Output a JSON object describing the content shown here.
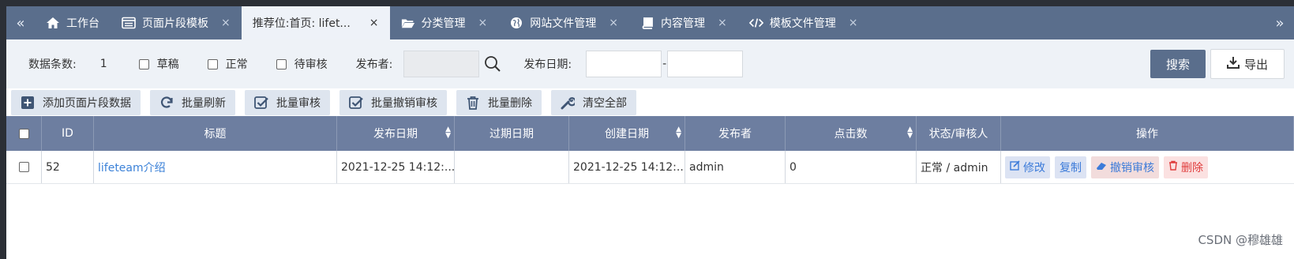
{
  "tabs": {
    "items": [
      {
        "label": "工作台",
        "icon": "home-icon"
      },
      {
        "label": "页面片段模板",
        "icon": "template-icon",
        "closable": true
      },
      {
        "label": "推荐位:首页: lifet...",
        "active": true,
        "closable": true
      },
      {
        "label": "分类管理",
        "icon": "folder-icon",
        "closable": true
      },
      {
        "label": "网站文件管理",
        "icon": "globe-icon",
        "closable": true
      },
      {
        "label": "内容管理",
        "icon": "book-icon",
        "closable": true
      },
      {
        "label": "模板文件管理",
        "icon": "code-icon",
        "closable": true
      }
    ],
    "close_glyph": "×",
    "prev_glyph": "«",
    "next_glyph": "»"
  },
  "search": {
    "count_label": "数据条数:",
    "count_value": "1",
    "status_options": [
      "草稿",
      "正常",
      "待审核"
    ],
    "publisher_label": "发布者:",
    "publisher_value": "",
    "date_label": "发布日期:",
    "date_from": "",
    "date_to": "",
    "date_sep": "-",
    "search_button": "搜索",
    "export_button": "导出"
  },
  "toolbar": {
    "buttons": [
      {
        "label": "添加页面片段数据",
        "icon": "plus-square-icon"
      },
      {
        "label": "批量刷新",
        "icon": "refresh-icon"
      },
      {
        "label": "批量审核",
        "icon": "check-square-icon"
      },
      {
        "label": "批量撤销审核",
        "icon": "check-square-icon"
      },
      {
        "label": "批量删除",
        "icon": "trash-icon"
      },
      {
        "label": "清空全部",
        "icon": "wrench-icon"
      }
    ]
  },
  "table": {
    "headers": [
      "ID",
      "标题",
      "发布日期",
      "过期日期",
      "创建日期",
      "发布者",
      "点击数",
      "状态/审核人",
      "操作"
    ],
    "rows": [
      {
        "id": "52",
        "title": "lifeteam介绍",
        "publish_date": "2021-12-25 14:12:...",
        "expire_date": "",
        "create_date": "2021-12-25 14:12:...",
        "publisher": "admin",
        "clicks": "0",
        "status": "正常 / admin",
        "actions": {
          "edit": "修改",
          "copy": "复制",
          "unreview": "撤销审核",
          "delete": "删除"
        }
      }
    ]
  },
  "watermark": "CSDN @穆雄雄",
  "colors": {
    "tabbar": "#5a6e8c",
    "header": "#6d7ea0",
    "link": "#3c82d8",
    "danger": "#e03c3c"
  }
}
